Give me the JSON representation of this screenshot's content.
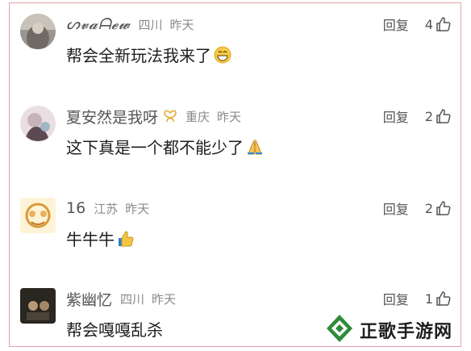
{
  "comments": [
    {
      "username": "ᔕ𝓿𝓪ᗩ𝓮𝔀",
      "region": "四川",
      "time": "昨天",
      "reply_label": "回复",
      "likes": "4",
      "text": "帮会全新玩法我来了",
      "emoji": "grinning-face-emoji"
    },
    {
      "username": "夏安然是我呀",
      "region": "重庆",
      "time": "昨天",
      "reply_label": "回复",
      "likes": "2",
      "text": "这下真是一个都不能少了",
      "emoji": "folded-hands-emoji",
      "badge": "butterfly-icon"
    },
    {
      "username": "16",
      "region": "江苏",
      "time": "昨天",
      "reply_label": "回复",
      "likes": "2",
      "text": "牛牛牛",
      "emoji": "thumbs-up-emoji"
    },
    {
      "username": "紫幽忆",
      "region": "四川",
      "time": "昨天",
      "reply_label": "回复",
      "likes": "1",
      "text": "帮会嘎嘎乱杀"
    }
  ],
  "watermark": {
    "text": "正歌手游网",
    "icon": "logo-icon"
  },
  "colors": {
    "frame": "#e7a0a8",
    "watermark_green": "#2e8b3a"
  }
}
